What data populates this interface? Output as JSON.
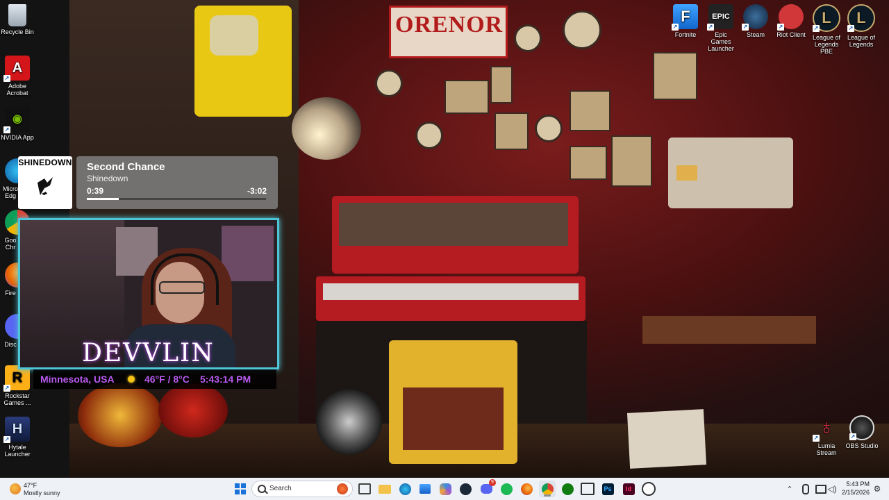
{
  "desktop": {
    "left_icons": [
      {
        "label": "Recycle Bin",
        "icon": "recycle-bin-icon"
      },
      {
        "label": "Adobe Acrobat",
        "icon": "adobe-acrobat-icon"
      },
      {
        "label": "NVIDIA App",
        "icon": "nvidia-icon"
      },
      {
        "label": "Micro Edg",
        "icon": "edge-icon"
      },
      {
        "label": "Goo Chr",
        "icon": "chrome-icon"
      },
      {
        "label": "Fire",
        "icon": "firefox-icon"
      },
      {
        "label": "Disc",
        "icon": "discord-icon"
      },
      {
        "label": "Rockstar Games ...",
        "icon": "rockstar-icon"
      },
      {
        "label": "Hytale Launcher",
        "icon": "hytale-icon"
      }
    ],
    "top_right_icons": [
      {
        "label": "Fortnite",
        "icon": "fortnite-icon",
        "glyph": "F"
      },
      {
        "label": "Epic Games Launcher",
        "icon": "epic-games-icon",
        "glyph": "EPIC"
      },
      {
        "label": "Steam",
        "icon": "steam-icon"
      },
      {
        "label": "Riot Client",
        "icon": "riot-client-icon"
      },
      {
        "label": "League of Legends PBE",
        "icon": "league-pbe-icon",
        "glyph": "L"
      },
      {
        "label": "League of Legends",
        "icon": "league-icon",
        "glyph": "L"
      }
    ],
    "bottom_right_icons": [
      {
        "label": "Lumia Stream",
        "icon": "lumia-stream-icon"
      },
      {
        "label": "OBS Studio",
        "icon": "obs-studio-icon"
      }
    ]
  },
  "now_playing": {
    "album_text": "SHINEDOWN",
    "title": "Second Chance",
    "artist": "Shinedown",
    "elapsed": "0:39",
    "remaining": "-3:02",
    "progress": 0.18
  },
  "webcam_overlay": {
    "name": "DEVVLIN",
    "location": "Minnesota, USA",
    "temperature": "46°F / 8°C",
    "time": "5:43:14 PM",
    "weather_icon": "sun-icon"
  },
  "taskbar": {
    "weather_temp": "47°F",
    "weather_condition": "Mostly sunny",
    "search_placeholder": "Search",
    "clock_time": "5:43 PM",
    "clock_date": "2/15/2026",
    "notification_count": "9"
  }
}
